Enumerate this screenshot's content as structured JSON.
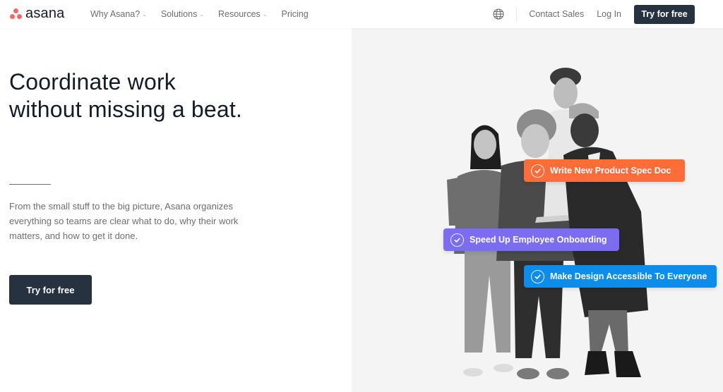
{
  "header": {
    "brand": "asana",
    "nav": [
      {
        "label": "Why Asana?",
        "has_dropdown": true
      },
      {
        "label": "Solutions",
        "has_dropdown": true
      },
      {
        "label": "Resources",
        "has_dropdown": true
      },
      {
        "label": "Pricing",
        "has_dropdown": false
      }
    ],
    "language_icon": "globe-icon",
    "contact_sales": "Contact Sales",
    "log_in": "Log In",
    "try_free": "Try for free"
  },
  "hero": {
    "headline_line1": "Coordinate work",
    "headline_line2": "without missing a beat.",
    "description": "From the small stuff to the big picture, Asana organizes everything so teams are clear what to do, why their work matters, and how to get it done.",
    "cta": "Try for free"
  },
  "tasks": [
    {
      "label": "Write New Product Spec Doc",
      "color": "#fc6d3a",
      "icon": "check-circle-icon"
    },
    {
      "label": "Speed Up Employee Onboarding",
      "color": "#7c6cf0",
      "icon": "check-circle-icon"
    },
    {
      "label": "Make Design Accessible To Everyone",
      "color": "#0d8ce9",
      "icon": "check-circle-icon"
    }
  ],
  "colors": {
    "brand_coral": "#f06a6a",
    "button_dark": "#273240",
    "hero_bg": "#f4f4f4"
  }
}
